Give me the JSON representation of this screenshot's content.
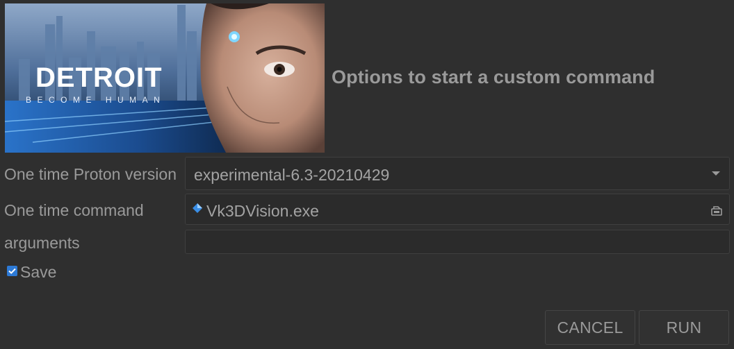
{
  "banner": {
    "logo_title": "DETROIT",
    "logo_subtitle": "BECOME HUMAN"
  },
  "dialog": {
    "title": "Options to start a custom command"
  },
  "form": {
    "proton_version": {
      "label": "One time Proton version",
      "value": "experimental-6.3-20210429"
    },
    "command": {
      "label": "One time command",
      "value": "Vk3DVision.exe"
    },
    "arguments": {
      "label": "arguments",
      "value": ""
    },
    "save": {
      "label": "Save",
      "checked": true
    }
  },
  "buttons": {
    "cancel": "CANCEL",
    "run": "RUN"
  },
  "colors": {
    "background": "#2f2f2f",
    "field_background": "#2b2b2b",
    "checkbox_accent": "#2d7ad6",
    "text": "#9a9a9a"
  }
}
